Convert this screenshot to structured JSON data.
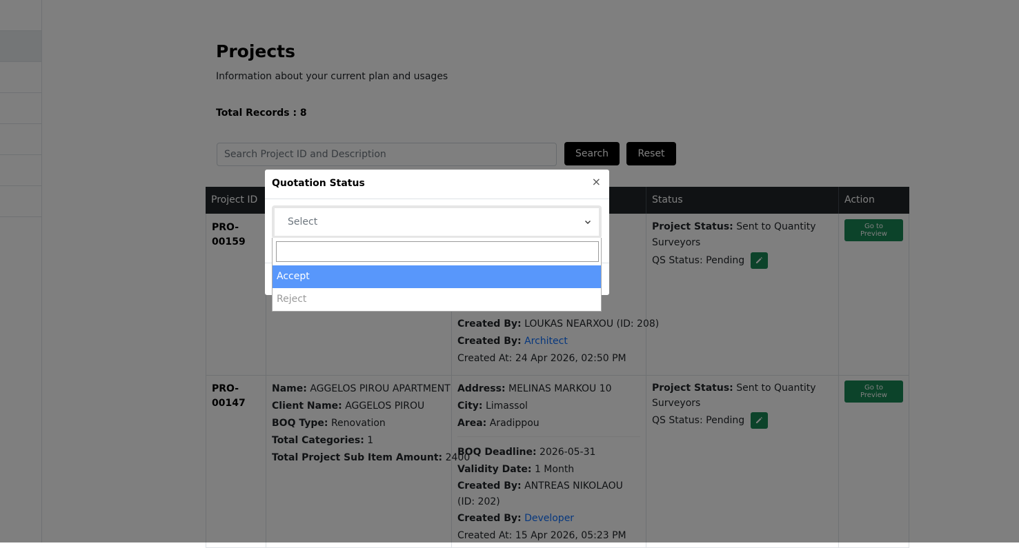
{
  "page": {
    "title": "Projects",
    "subtitle": "Information about your current plan and usages",
    "total_records": "Total Records : 8"
  },
  "search": {
    "placeholder": "Search Project ID and Description",
    "search_label": "Search",
    "reset_label": "Reset"
  },
  "table": {
    "headers": [
      "Project ID",
      "",
      "",
      "Status",
      "Action"
    ],
    "rows": [
      {
        "id": "PRO-00159",
        "created_by": "LOUKAS NEARXOU (ID: 208)",
        "created_by_role": "Architect",
        "created_at": "Created At: 24 Apr 2026, 02:50 PM",
        "project_status": "Sent to Quantity Surveyors",
        "qs_status": "QS Status: Pending",
        "action_label": "Go to Preview"
      },
      {
        "id": "PRO-00147",
        "name": "AGGELOS PIROU APARTMENT",
        "client_name": "AGGELOS PIROU",
        "boq_type": "Renovation",
        "total_categories": "1",
        "total_sub_item_amount": "2400",
        "address": "MELINAS MARKOU 10",
        "city": "Limassol",
        "area": "Aradippou",
        "boq_deadline": "2026-05-31",
        "validity_date": "1 Month",
        "created_by": "ANTREAS NIKOLAOU (ID: 202)",
        "created_by_role": "Developer",
        "created_at": "Created At: 15 Apr 2026, 05:23 PM",
        "project_status": "Sent to Quantity Surveyors",
        "qs_status": "QS Status: Pending",
        "action_label": "Go to Preview"
      }
    ],
    "labels": {
      "name": "Name:",
      "client_name": "Client Name:",
      "boq_type": "BOQ Type:",
      "total_categories": "Total Categories:",
      "total_sub_item_amount": "Total Project Sub Item Amount:",
      "address": "Address:",
      "city": "City:",
      "area": "Area:",
      "boq_deadline": "BOQ Deadline:",
      "validity_date": "Validity Date:",
      "created_by": "Created By:",
      "project_status": "Project Status:"
    }
  },
  "modal": {
    "title": "Quotation Status",
    "close": "×",
    "select_placeholder": "Select",
    "options": [
      "Accept",
      "Reject"
    ]
  },
  "colors": {
    "header_bg": "#212529",
    "success": "#198754",
    "highlight": "#5897fb",
    "link": "#0d6efd"
  }
}
